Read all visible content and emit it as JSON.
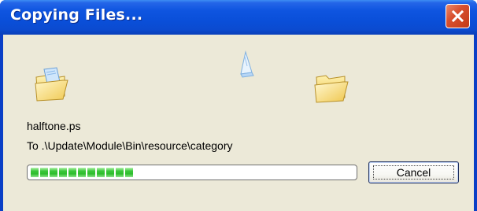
{
  "window": {
    "title": "Copying Files...",
    "title_color": "#ffffff",
    "titlebar_color": "#0a4fd9",
    "client_color": "#ece9d8"
  },
  "icons": {
    "source": "folder-with-document-icon",
    "flying_document": "flying-document-icon",
    "destination": "folder-icon",
    "close": "close-icon"
  },
  "operation": {
    "file_name": "halftone.ps",
    "destination_path": "To .\\Update\\Module\\Bin\\resource\\category"
  },
  "progress": {
    "percent": 31,
    "bar_color": "#3ac73a"
  },
  "buttons": {
    "cancel_label": "Cancel"
  }
}
